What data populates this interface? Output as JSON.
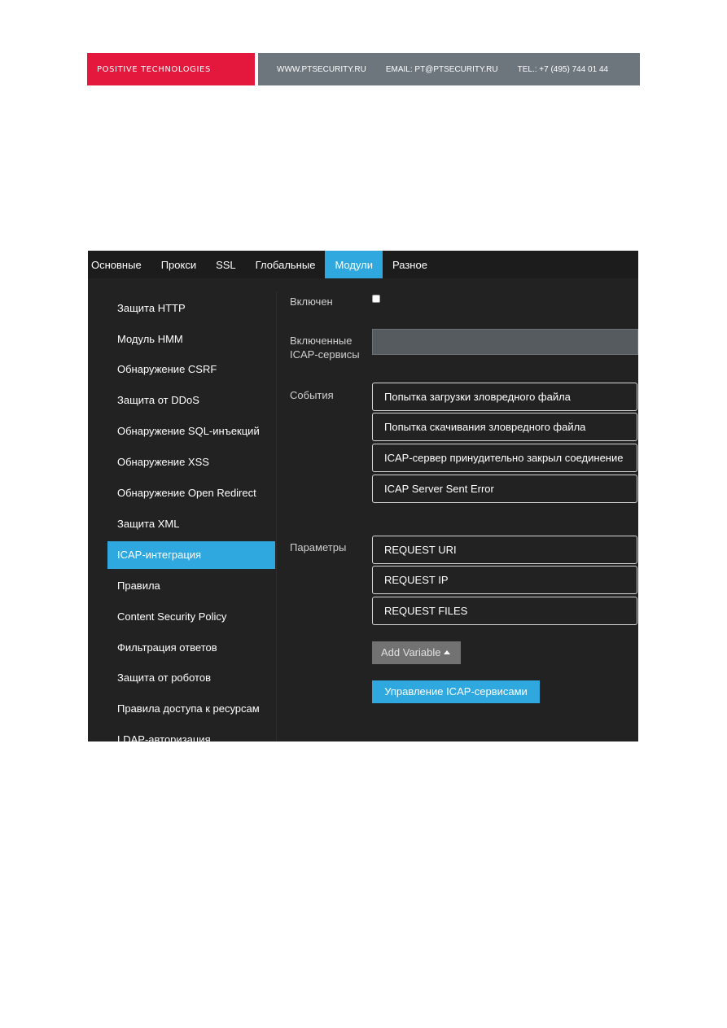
{
  "banner": {
    "brand": "POSITIVE TECHNOLOGIES",
    "website": "WWW.PTSECURITY.RU",
    "email": "EMAIL: PT@PTSECURITY.RU",
    "phone": "TEL.: +7 (495) 744 01 44"
  },
  "tabs": [
    {
      "label": "Основные"
    },
    {
      "label": "Прокси"
    },
    {
      "label": "SSL"
    },
    {
      "label": "Глобальные"
    },
    {
      "label": "Модули",
      "active": true
    },
    {
      "label": "Разное"
    }
  ],
  "sidebar": {
    "items": [
      {
        "label": "Защита HTTP"
      },
      {
        "label": "Модуль HMM"
      },
      {
        "label": "Обнаружение CSRF"
      },
      {
        "label": "Защита от DDoS"
      },
      {
        "label": "Обнаружение SQL-инъекций"
      },
      {
        "label": "Обнаружение XSS"
      },
      {
        "label": "Обнаружение Open Redirect"
      },
      {
        "label": "Защита XML"
      },
      {
        "label": "ICAP-интеграция",
        "active": true
      },
      {
        "label": "Правила"
      },
      {
        "label": "Content Security Policy"
      },
      {
        "label": "Фильтрация ответов"
      },
      {
        "label": "Защита от роботов"
      },
      {
        "label": "Правила доступа к ресурсам"
      },
      {
        "label": "LDAP-авторизация"
      }
    ]
  },
  "form": {
    "enabled_label": "Включен",
    "enabled_checked": false,
    "icap_services_label": "Включенные ICAP-сервисы",
    "icap_services_value": "",
    "events_label": "События",
    "events": [
      "Попытка загрузки зловредного файла",
      "Попытка скачивания зловредного файла",
      "ICAP-сервер принудительно закрыл соединение",
      "ICAP Server Sent Error"
    ],
    "params_label": "Параметры",
    "params": [
      "REQUEST URI",
      "REQUEST IP",
      "REQUEST FILES"
    ],
    "add_variable_label": "Add Variable",
    "manage_button_label": "Управление ICAP-сервисами"
  },
  "colors": {
    "brand_red": "#e4183d",
    "banner_gray": "#6e767d",
    "accent": "#2ea8df",
    "background": "#222222"
  }
}
